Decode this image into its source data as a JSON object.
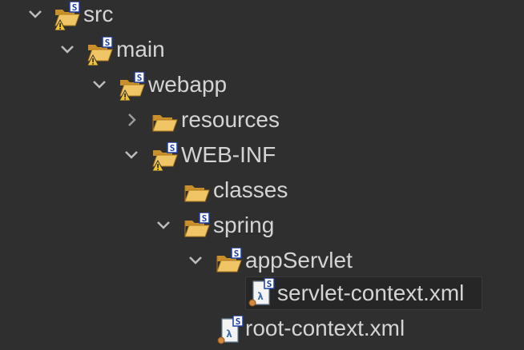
{
  "tree": {
    "items": [
      {
        "label": "src",
        "type": "folder-open-warning-spring",
        "expanded": true
      },
      {
        "label": "main",
        "type": "folder-open-warning-spring",
        "expanded": true
      },
      {
        "label": "webapp",
        "type": "folder-open-warning-spring",
        "expanded": true
      },
      {
        "label": "resources",
        "type": "folder-open",
        "expanded": false
      },
      {
        "label": "WEB-INF",
        "type": "folder-open-warning-spring",
        "expanded": true
      },
      {
        "label": "classes",
        "type": "folder-open",
        "expanded": null
      },
      {
        "label": "spring",
        "type": "folder-open-spring",
        "expanded": true
      },
      {
        "label": "appServlet",
        "type": "folder-open-spring",
        "expanded": true
      },
      {
        "label": "servlet-context.xml",
        "type": "spring-xml-file",
        "selected": true
      },
      {
        "label": "root-context.xml",
        "type": "spring-xml-file",
        "selected": false
      }
    ]
  },
  "colors": {
    "background": "#2f2f2f",
    "text": "#d4d4d4",
    "folder": "#e8b84e",
    "spring_badge": "#1a3fa8",
    "warning": "#f2c230"
  }
}
